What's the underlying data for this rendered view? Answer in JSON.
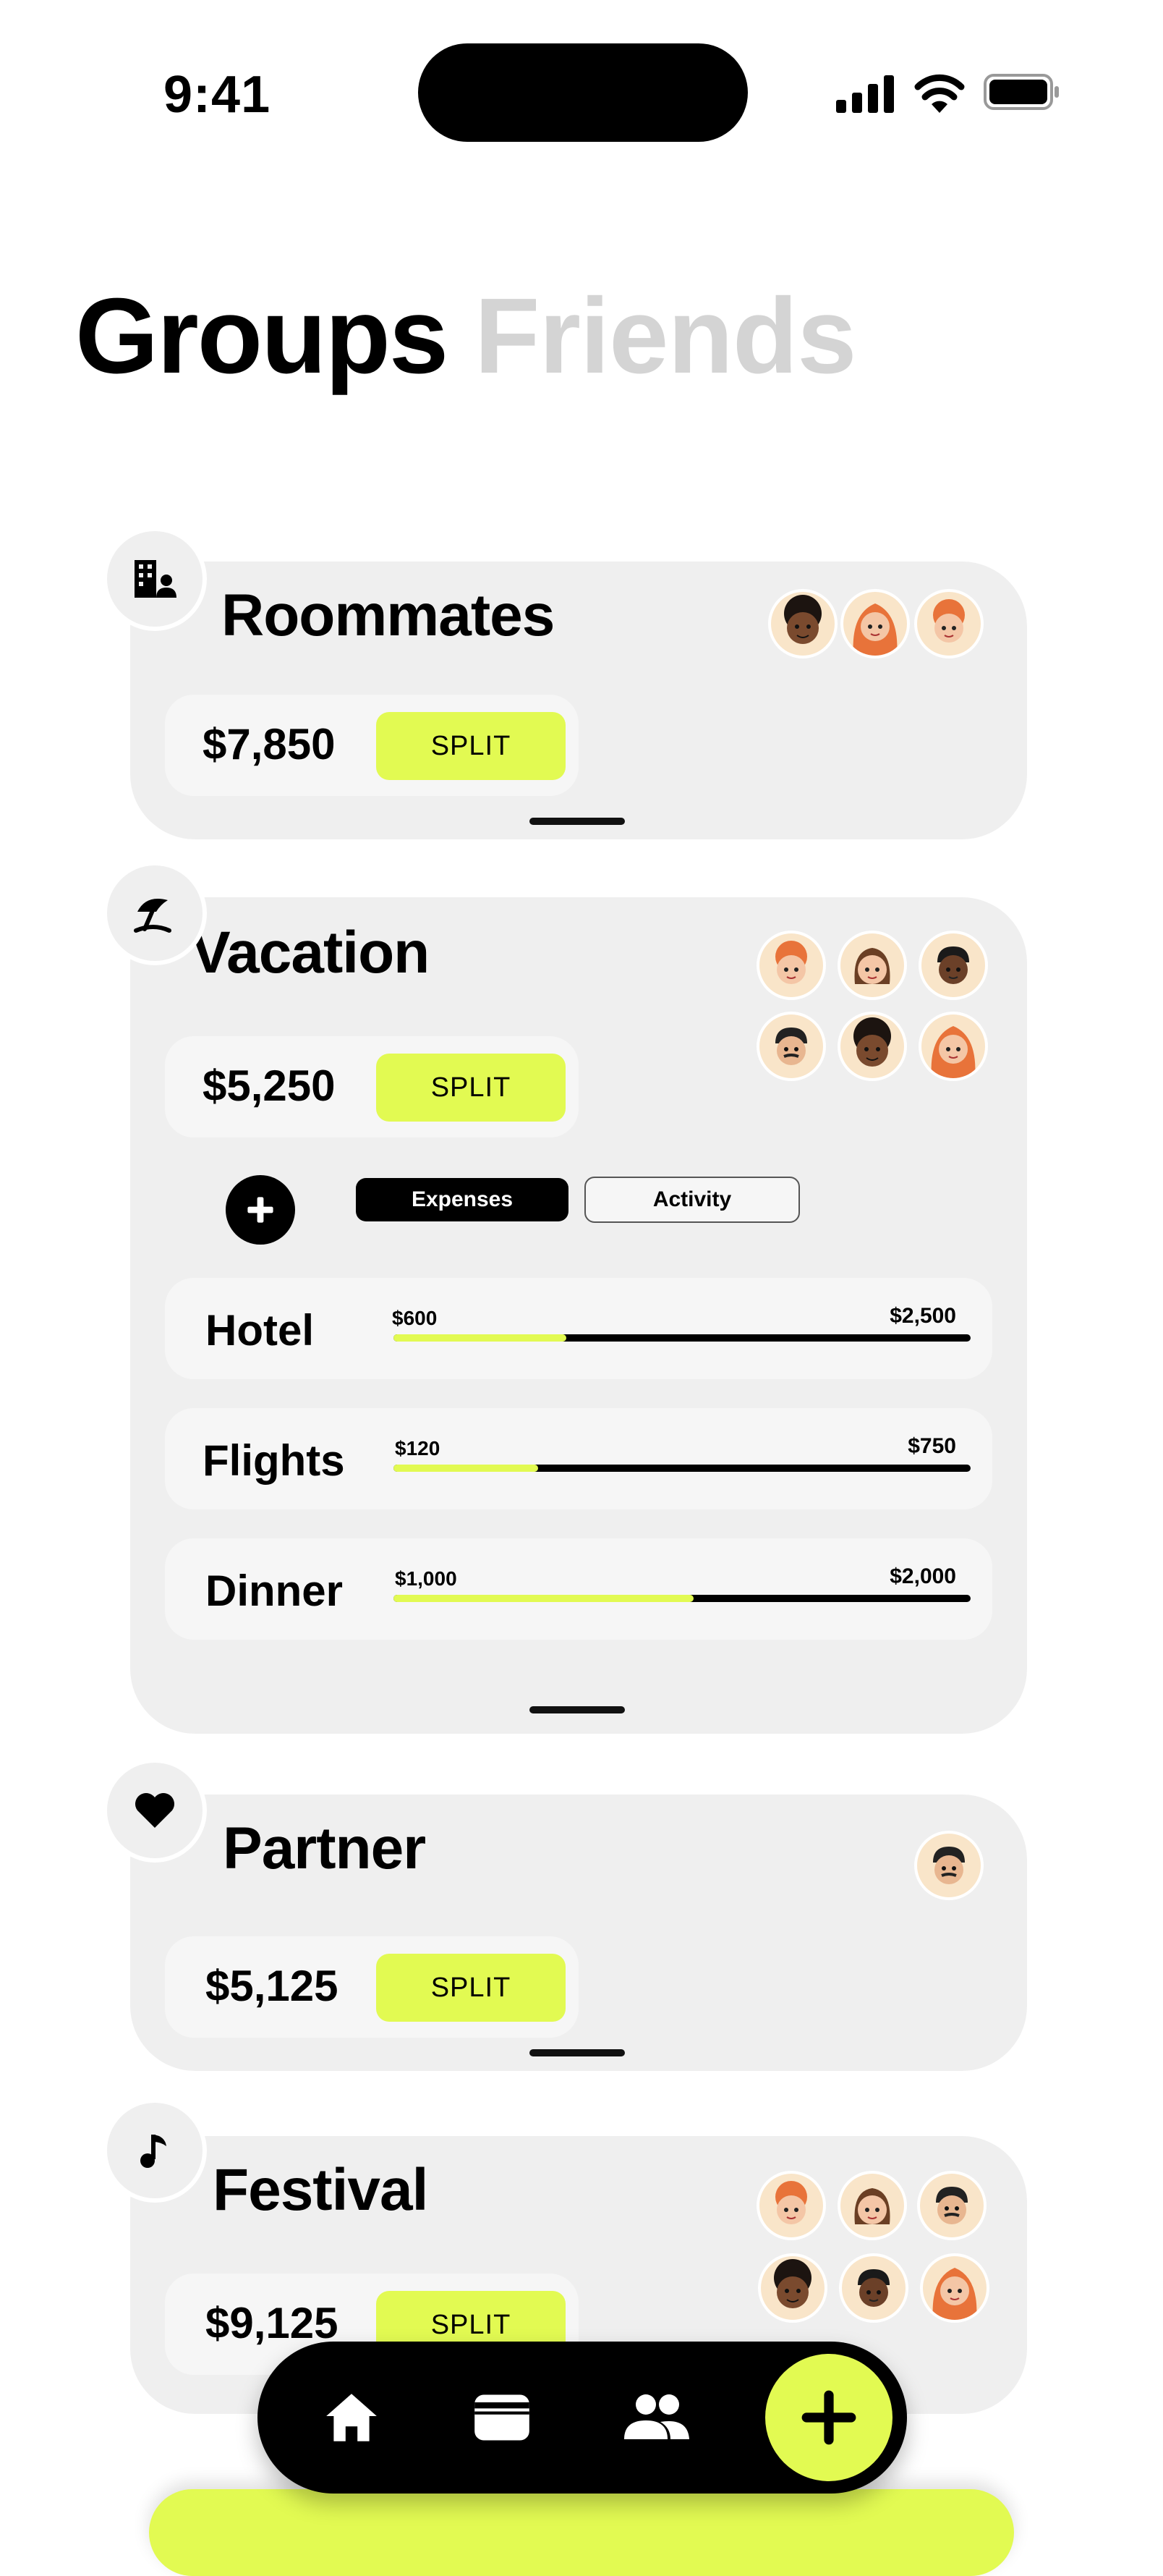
{
  "status_bar": {
    "time": "9:41",
    "icons": [
      "cellular-signal-icon",
      "wifi-icon",
      "battery-icon"
    ]
  },
  "header": {
    "tabs": [
      {
        "label": "Groups",
        "active": true
      },
      {
        "label": "Friends",
        "active": false
      }
    ]
  },
  "groups": [
    {
      "name": "Roommates",
      "icon": "building-person-icon",
      "amount": "$7,850",
      "split_label": "SPLIT",
      "members": 3
    },
    {
      "name": "Vacation",
      "icon": "beach-umbrella-icon",
      "amount": "$5,250",
      "split_label": "SPLIT",
      "members": 6,
      "segments": [
        {
          "label": "Expenses",
          "active": true
        },
        {
          "label": "Activity",
          "active": false
        }
      ],
      "expenses": [
        {
          "name": "Hotel",
          "paid": "$600",
          "total": "$2,500",
          "progress": 0.3
        },
        {
          "name": "Flights",
          "paid": "$120",
          "total": "$750",
          "progress": 0.25
        },
        {
          "name": "Dinner",
          "paid": "$1,000",
          "total": "$2,000",
          "progress": 0.52
        }
      ]
    },
    {
      "name": "Partner",
      "icon": "heart-icon",
      "amount": "$5,125",
      "split_label": "SPLIT",
      "members": 1
    },
    {
      "name": "Festival",
      "icon": "music-note-icon",
      "amount": "$9,125",
      "split_label": "SPLIT",
      "members": 6
    }
  ],
  "bottom_nav": {
    "items": [
      "home-icon",
      "wallet-icon",
      "people-icon",
      "add-icon"
    ]
  },
  "colors": {
    "accent": "#e2fa52",
    "card_bg": "#efefef",
    "text": "#000000",
    "inactive_tab": "#d4d4d4"
  }
}
